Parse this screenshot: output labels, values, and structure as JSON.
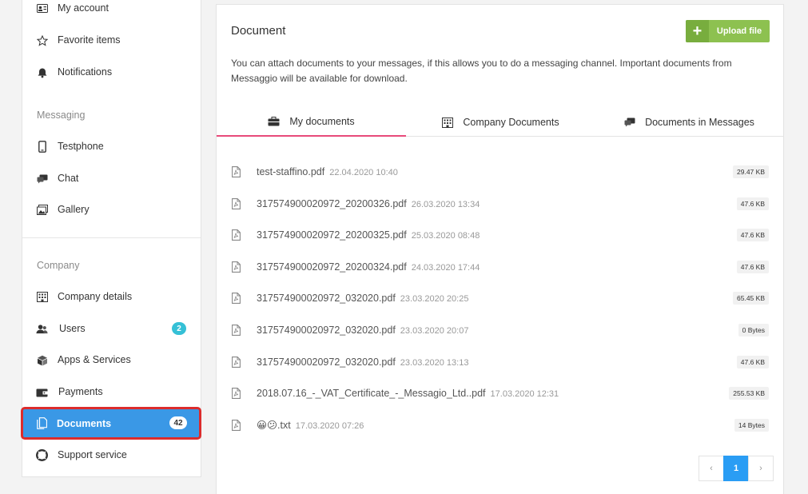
{
  "sidebar": {
    "account_items": [
      {
        "label": "My account",
        "icon": "id-card-icon"
      },
      {
        "label": "Favorite items",
        "icon": "star-icon"
      },
      {
        "label": "Notifications",
        "icon": "bell-icon"
      }
    ],
    "messaging_title": "Messaging",
    "messaging_items": [
      {
        "label": "Testphone",
        "icon": "phone-icon"
      },
      {
        "label": "Chat",
        "icon": "chat-icon"
      },
      {
        "label": "Gallery",
        "icon": "gallery-icon"
      }
    ],
    "company_title": "Company",
    "company_items": [
      {
        "label": "Company details",
        "icon": "building-icon"
      },
      {
        "label": "Users",
        "icon": "users-icon",
        "badge": "2"
      },
      {
        "label": "Apps & Services",
        "icon": "cube-icon"
      },
      {
        "label": "Payments",
        "icon": "wallet-icon"
      },
      {
        "label": "Documents",
        "icon": "documents-icon",
        "badge": "42",
        "active": true
      },
      {
        "label": "Support service",
        "icon": "lifebuoy-icon"
      }
    ]
  },
  "main": {
    "title": "Document",
    "upload_label": "Upload file",
    "description": "You can attach documents to your messages, if this allows you to do a messaging channel. Important documents from Messaggio will be available for download.",
    "tabs": [
      {
        "label": "My documents",
        "icon": "briefcase-icon",
        "active": true
      },
      {
        "label": "Company Documents",
        "icon": "building-icon"
      },
      {
        "label": "Documents in Messages",
        "icon": "chat-icon"
      }
    ],
    "files": [
      {
        "name": "test-staffino.pdf",
        "date": "22.04.2020 10:40",
        "size": "29.47 KB"
      },
      {
        "name": "317574900020972_20200326.pdf",
        "date": "26.03.2020 13:34",
        "size": "47.6 KB"
      },
      {
        "name": "317574900020972_20200325.pdf",
        "date": "25.03.2020 08:48",
        "size": "47.6 KB"
      },
      {
        "name": "317574900020972_20200324.pdf",
        "date": "24.03.2020 17:44",
        "size": "47.6 KB"
      },
      {
        "name": "317574900020972_032020.pdf",
        "date": "23.03.2020 20:25",
        "size": "65.45 KB"
      },
      {
        "name": "317574900020972_032020.pdf",
        "date": "23.03.2020 20:07",
        "size": "0 Bytes"
      },
      {
        "name": "317574900020972_032020.pdf",
        "date": "23.03.2020 13:13",
        "size": "47.6 KB"
      },
      {
        "name": "2018.07.16_-_VAT_Certificate_-_Messagio_Ltd..pdf",
        "date": "17.03.2020 12:31",
        "size": "255.53 KB"
      },
      {
        "name": "😀😕.txt",
        "date": "17.03.2020 07:26",
        "size": "14 Bytes"
      }
    ],
    "pagination": {
      "prev": "‹",
      "current": "1",
      "next": "›"
    }
  },
  "colors": {
    "active_nav": "#3a98e6",
    "highlight_border": "#dc2c2c",
    "upload_green": "#8dc150",
    "tab_underline": "#e84a7a",
    "users_badge": "#35c0d6",
    "page_current": "#2a9df4"
  }
}
